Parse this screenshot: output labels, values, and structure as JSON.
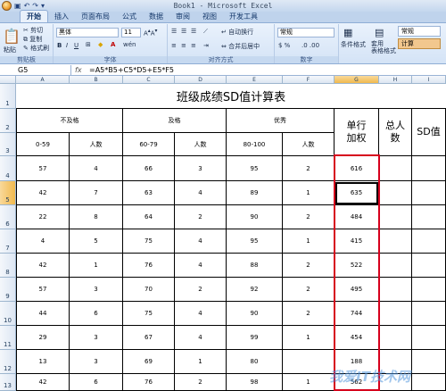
{
  "window": {
    "title": "Book1 - Microsoft Excel",
    "tabs": [
      "开始",
      "插入",
      "页面布局",
      "公式",
      "数据",
      "审阅",
      "视图",
      "开发工具"
    ]
  },
  "ribbon": {
    "clipboard": {
      "paste": "粘贴",
      "cut": "剪切",
      "copy": "复制",
      "format_painter": "格式刷",
      "name": "剪贴板"
    },
    "font": {
      "font_name": "黑体",
      "font_size": "11",
      "name": "字体"
    },
    "alignment": {
      "wrap": "自动换行",
      "merge": "合并后居中",
      "name": "对齐方式"
    },
    "number": {
      "format": "常规",
      "name": "数字"
    },
    "styles": {
      "conditional": "条件格式",
      "table": "套用\n表格格式",
      "normal": "常规",
      "calc": "计算"
    }
  },
  "formula_bar": {
    "name_box": "G5",
    "fx": "fx",
    "formula": "=A5*B5+C5*D5+E5*F5"
  },
  "columns": [
    "A",
    "B",
    "C",
    "D",
    "E",
    "F",
    "G",
    "H",
    "I"
  ],
  "rows": [
    "1",
    "2",
    "3",
    "4",
    "5",
    "6",
    "7",
    "8",
    "9",
    "10",
    "11",
    "12",
    "13"
  ],
  "sheet": {
    "title": "班级成绩SD值计算表",
    "group_fail": "不及格",
    "group_pass": "及格",
    "group_excellent": "优秀",
    "row_weight": "单行\n加权",
    "total_count": "总人\n数",
    "sd_value": "SD值",
    "sub_headers": [
      "0-59",
      "人数",
      "60-79",
      "人数",
      "80-100",
      "人数"
    ],
    "data": [
      [
        "57",
        "4",
        "66",
        "3",
        "95",
        "2",
        "616"
      ],
      [
        "42",
        "7",
        "63",
        "4",
        "89",
        "1",
        "635"
      ],
      [
        "22",
        "8",
        "64",
        "2",
        "90",
        "2",
        "484"
      ],
      [
        "4",
        "5",
        "75",
        "4",
        "95",
        "1",
        "415"
      ],
      [
        "42",
        "1",
        "76",
        "4",
        "88",
        "2",
        "522"
      ],
      [
        "57",
        "3",
        "70",
        "2",
        "92",
        "2",
        "495"
      ],
      [
        "44",
        "6",
        "75",
        "4",
        "90",
        "2",
        "744"
      ],
      [
        "29",
        "3",
        "67",
        "4",
        "99",
        "1",
        "454"
      ],
      [
        "13",
        "3",
        "69",
        "1",
        "80",
        "",
        "188"
      ],
      [
        "42",
        "6",
        "76",
        "2",
        "98",
        "1",
        "562"
      ]
    ]
  },
  "watermark": "我爱IT技术网"
}
